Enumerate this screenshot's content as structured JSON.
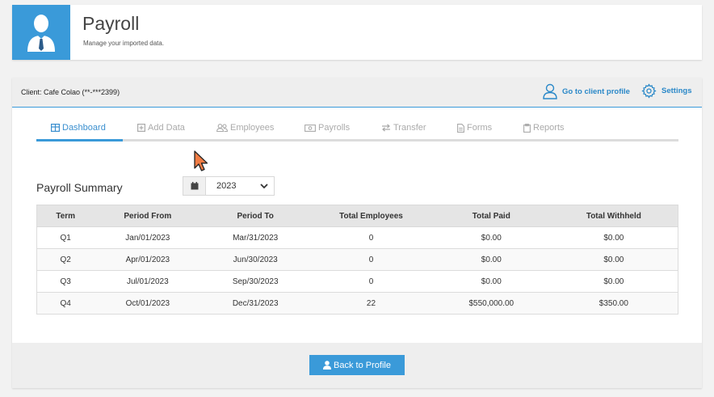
{
  "header": {
    "title": "Payroll",
    "subtitle": "Manage your imported data."
  },
  "client": {
    "label": "Client: Cafe Colao (**-***2399)",
    "profile_link": "Go to client profile",
    "settings_link": "Settings"
  },
  "tabs": [
    {
      "label": "Dashboard",
      "icon": "table-icon",
      "active": true
    },
    {
      "label": "Add Data",
      "icon": "plus-square-icon"
    },
    {
      "label": "Employees",
      "icon": "users-icon"
    },
    {
      "label": "Payrolls",
      "icon": "money-icon"
    },
    {
      "label": "Transfer",
      "icon": "exchange-icon"
    },
    {
      "label": "Forms",
      "icon": "file-icon"
    },
    {
      "label": "Reports",
      "icon": "clipboard-icon"
    }
  ],
  "summary": {
    "title": "Payroll Summary",
    "year": "2023",
    "columns": [
      "Term",
      "Period From",
      "Period To",
      "Total Employees",
      "Total Paid",
      "Total Withheld"
    ],
    "rows": [
      [
        "Q1",
        "Jan/01/2023",
        "Mar/31/2023",
        "0",
        "$0.00",
        "$0.00"
      ],
      [
        "Q2",
        "Apr/01/2023",
        "Jun/30/2023",
        "0",
        "$0.00",
        "$0.00"
      ],
      [
        "Q3",
        "Jul/01/2023",
        "Sep/30/2023",
        "0",
        "$0.00",
        "$0.00"
      ],
      [
        "Q4",
        "Oct/01/2023",
        "Dec/31/2023",
        "22",
        "$550,000.00",
        "$350.00"
      ]
    ]
  },
  "footer": {
    "back_label": "Back to Profile"
  },
  "colors": {
    "accent": "#3a9ad9",
    "link": "#2a88c8"
  }
}
